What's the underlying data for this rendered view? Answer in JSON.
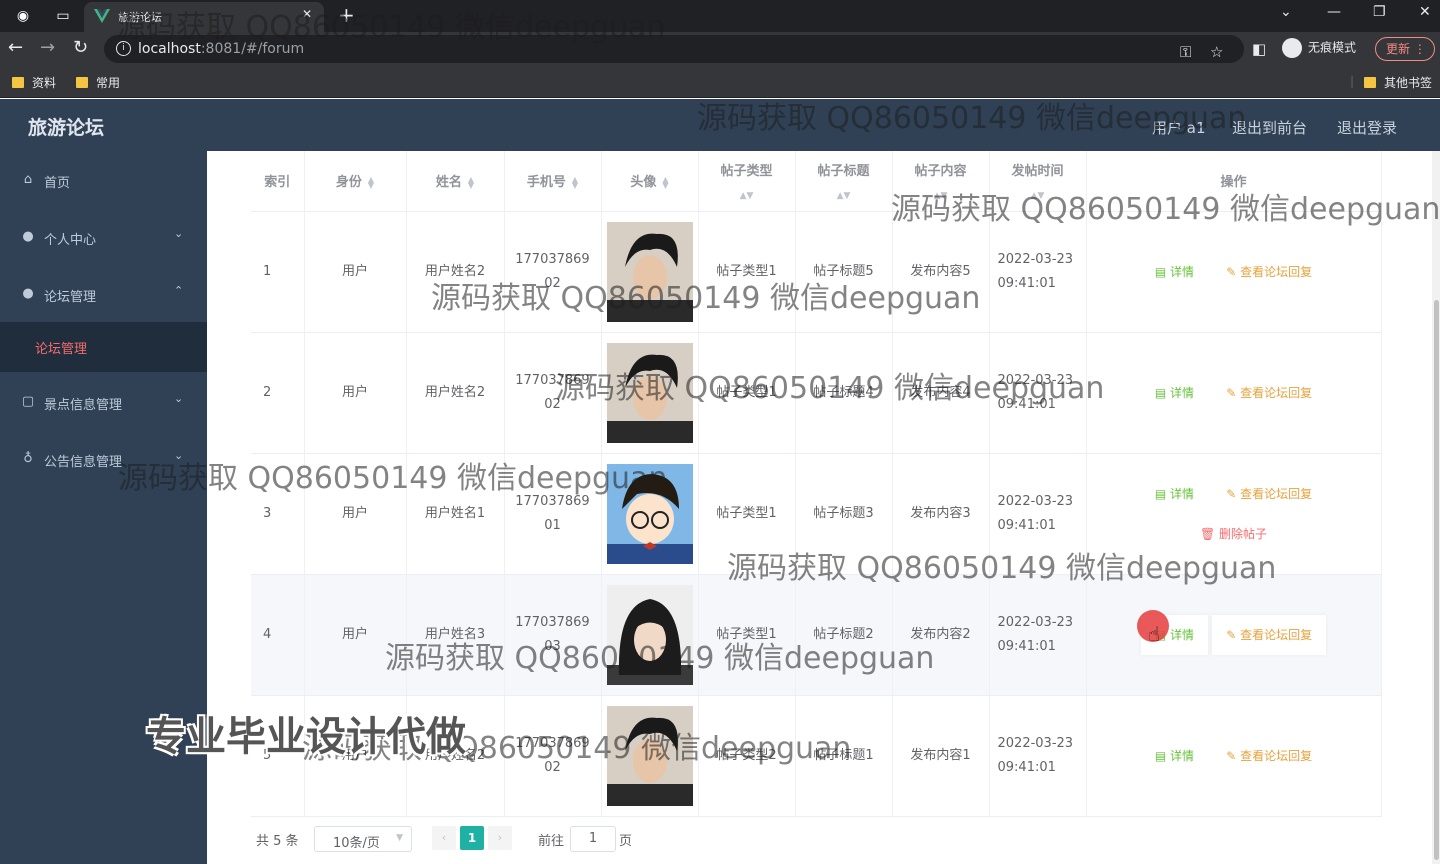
{
  "browser": {
    "tab_title": "旅游论坛",
    "url_host": "localhost",
    "url_rest": ":8081/#/forum",
    "incognito_label": "无痕模式",
    "update_label": "更新",
    "bookmarks": [
      "资料",
      "常用"
    ],
    "other_bookmarks": "其他书签"
  },
  "app": {
    "title": "旅游论坛",
    "user_label": "用户 a1",
    "back_to_front": "退出到前台",
    "logout": "退出登录"
  },
  "sidebar": {
    "items": [
      {
        "label": "首页",
        "icon": "home-icon"
      },
      {
        "label": "个人中心",
        "icon": "user-icon"
      },
      {
        "label": "论坛管理",
        "icon": "user-icon"
      },
      {
        "label": "景点信息管理",
        "icon": "document-icon"
      },
      {
        "label": "公告信息管理",
        "icon": "microphone-icon"
      }
    ],
    "sub_item": "论坛管理"
  },
  "table": {
    "headers": {
      "index": "索引",
      "identity": "身份",
      "name": "姓名",
      "phone": "手机号",
      "avatar": "头像",
      "post_type": "帖子类型",
      "post_title": "帖子标题",
      "post_content": "帖子内容",
      "post_time": "发帖时间",
      "actions": "操作"
    },
    "rows": [
      {
        "index": "1",
        "identity": "用户",
        "name": "用户姓名2",
        "phone": "17703786902",
        "avatar": "man",
        "post_type": "帖子类型1",
        "post_title": "帖子标题5",
        "post_content": "发布内容5",
        "post_time": "2022-03-23 09:41:01"
      },
      {
        "index": "2",
        "identity": "用户",
        "name": "用户姓名2",
        "phone": "17703786902",
        "avatar": "man",
        "post_type": "帖子类型1",
        "post_title": "帖子标题4",
        "post_content": "发布内容4",
        "post_time": "2022-03-23 09:41:01"
      },
      {
        "index": "3",
        "identity": "用户",
        "name": "用户姓名1",
        "phone": "17703786901",
        "avatar": "cartoon",
        "post_type": "帖子类型1",
        "post_title": "帖子标题3",
        "post_content": "发布内容3",
        "post_time": "2022-03-23 09:41:01"
      },
      {
        "index": "4",
        "identity": "用户",
        "name": "用户姓名3",
        "phone": "17703786903",
        "avatar": "woman",
        "post_type": "帖子类型1",
        "post_title": "帖子标题2",
        "post_content": "发布内容2",
        "post_time": "2022-03-23 09:41:01"
      },
      {
        "index": "5",
        "identity": "用户",
        "name": "用户姓名2",
        "phone": "17703786902",
        "avatar": "man",
        "post_type": "帖子类型2",
        "post_title": "帖子标题1",
        "post_content": "发布内容1",
        "post_time": "2022-03-23 09:41:01"
      }
    ],
    "actions": {
      "detail": "详情",
      "view_reply": "查看论坛回复",
      "delete": "删除帖子"
    }
  },
  "pagination": {
    "total": "共 5 条",
    "page_size": "10条/页",
    "current_page": "1",
    "goto_label": "前往",
    "goto_value": "1",
    "page_suffix": "页"
  },
  "watermarks": {
    "text": "源码获取 QQ86050149 微信deepguan",
    "big": "专业毕业设计代做"
  }
}
